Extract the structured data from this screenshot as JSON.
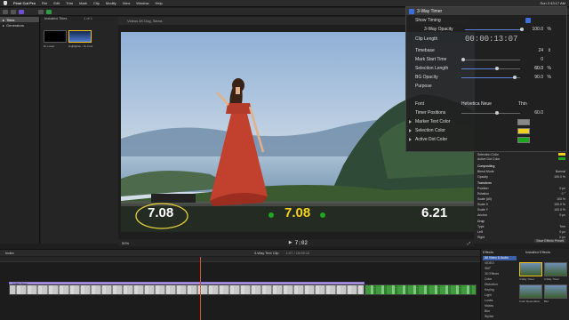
{
  "menubar": {
    "app": "Final Cut Pro",
    "items": [
      "File",
      "Edit",
      "Trim",
      "Mark",
      "Clip",
      "Modify",
      "View",
      "Window",
      "Help"
    ],
    "clock": "Sun 2:43:17 AM"
  },
  "sidebar": {
    "items": [
      {
        "label": "Titles",
        "selected": true
      },
      {
        "label": "Generators",
        "selected": false
      }
    ]
  },
  "browser": {
    "header": "Installed Titles",
    "count": "1 of 1",
    "clips": [
      {
        "label": "8+ Lower"
      },
      {
        "label": "Highlighter - 8+ Font",
        "selected": true
      }
    ]
  },
  "viewer": {
    "left_title": "Videos 4K Dog, Sierra",
    "right_title": "3-Way Text Clip",
    "timecode": "7:02",
    "zoom": "50%",
    "timers": [
      {
        "text": "7.08",
        "color": "#ffffff"
      },
      {
        "text": "7.08",
        "color": "#f3d21f"
      },
      {
        "text": "6.21",
        "color": "#ffffff"
      }
    ]
  },
  "hud": {
    "title": "3-Way Timer",
    "rows": [
      {
        "label": "Show Timing",
        "type": "check"
      },
      {
        "label": "3-Way Opacity",
        "value": "100.0",
        "unit": "%",
        "slider": 1.0
      },
      {
        "label": "Clip Length",
        "value": "00:00:13:07",
        "type": "timecode"
      },
      {
        "label": "Timebase",
        "value": "24",
        "type": "stepper"
      },
      {
        "label": "Mark Start Time",
        "value": "0",
        "slider": 0.0
      },
      {
        "label": "Selection Length",
        "value": "60.0",
        "unit": "%",
        "slider": 0.6
      },
      {
        "label": "BG Opacity",
        "value": "90.0",
        "unit": "%",
        "slider": 0.9
      },
      {
        "label": "Purpose"
      },
      {
        "label": "Font",
        "value": "Helvetica Neue",
        "extra": "Thin"
      },
      {
        "label": "Timer Positions",
        "value": "60.0",
        "slider": 0.6
      },
      {
        "label": "Marker Text Color",
        "swatch": "#888888"
      },
      {
        "label": "Selection Color",
        "swatch": "#f3d21f"
      },
      {
        "label": "Active Dot Color",
        "swatch": "#1fa61f"
      }
    ]
  },
  "inspector": {
    "rows": [
      {
        "label": "Selection Color",
        "value": ""
      },
      {
        "label": "Active Dot Color",
        "value": ""
      },
      {
        "label": "Compositing",
        "value": ""
      },
      {
        "label": "Blend Mode",
        "value": "Normal"
      },
      {
        "label": "Opacity",
        "value": "100.0 %"
      },
      {
        "label": "Transform",
        "value": ""
      },
      {
        "label": "Position",
        "value": "0 px"
      },
      {
        "label": "Rotation",
        "value": "0 °"
      },
      {
        "label": "Scale (All)",
        "value": "100 %"
      },
      {
        "label": "Scale X",
        "value": "100.0 %"
      },
      {
        "label": "Scale Y",
        "value": "100.0 %"
      },
      {
        "label": "Anchor",
        "value": "0 px"
      },
      {
        "label": "Crop",
        "value": ""
      },
      {
        "label": "Type",
        "value": "Trim"
      },
      {
        "label": "Left",
        "value": "0 px"
      },
      {
        "label": "Right",
        "value": "0 px"
      }
    ],
    "save_button": "Save Effects Preset"
  },
  "timeline": {
    "index": "Index",
    "project": "3-Way Text Clip",
    "timecode": "1:07 / 15:05:12",
    "clip_label": "3-Way Timer"
  },
  "effects": {
    "header": "Effects",
    "installed": "Installed Effects",
    "categories": [
      "All Video & Audio",
      "VIDEO",
      "360°",
      "3D Effects",
      "Color",
      "Distortion",
      "Keying",
      "Light",
      "Looks",
      "Masks",
      "Blur",
      "Stylize"
    ],
    "thumbs": [
      {
        "label": "3-Way Timer"
      },
      {
        "label": "3-Way Timer"
      },
      {
        "label": "Color Restoration"
      },
      {
        "label": "Blur"
      }
    ]
  },
  "colors": {
    "accent_purple": "#6f4fd3",
    "selection_yellow": "#f3d21f",
    "active_green": "#1fa61f",
    "slider_blue": "#5b82d8"
  }
}
